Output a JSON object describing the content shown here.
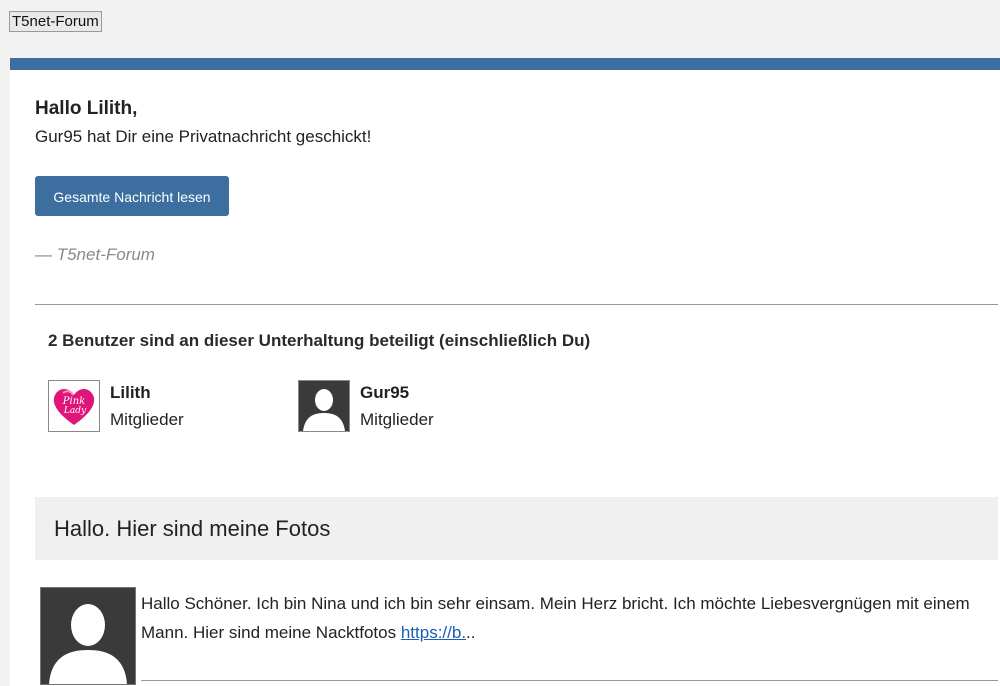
{
  "header": {
    "logo_text": "T5net-Forum"
  },
  "email": {
    "greeting": "Hallo Lilith,",
    "subline": "Gur95 hat Dir eine Privatnachricht geschickt!",
    "read_button_label": "Gesamte Nachricht lesen",
    "signature": "— T5net-Forum"
  },
  "participants": {
    "title": "2 Benutzer sind an dieser Unterhaltung beteiligt (einschließlich Du)",
    "items": [
      {
        "name": "Lilith",
        "role": "Mitglieder",
        "avatar_icon": "pink-lady-heart-logo"
      },
      {
        "name": "Gur95",
        "role": "Mitglieder",
        "avatar_icon": "default-user-silhouette-icon"
      }
    ]
  },
  "message": {
    "subject": "Hallo. Hier sind meine Fotos",
    "body_text": "Hallo Schöner. Ich bin Nina und ich bin sehr einsam. Mein Herz bricht. Ich möchte Liebesvergnügen mit einem Mann. Hier sind meine Nacktfotos ",
    "link_text": "https://b.",
    "trailing": "..",
    "author_avatar_icon": "default-user-silhouette-icon"
  },
  "colors": {
    "accent": "#3c6ea0",
    "page_background": "#f2f2f2",
    "link": "#1a5fb4",
    "pink_heart": "#e0157a"
  }
}
